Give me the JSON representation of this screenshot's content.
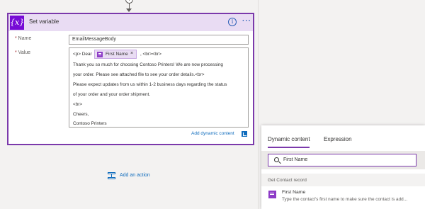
{
  "card": {
    "title": "Set variable",
    "icon_glyph": "{x}",
    "info_glyph": "i",
    "more_glyph": "···",
    "accent_color": "#7b39ab",
    "name_label": "Name",
    "name_value": "EmailMessageBody",
    "value_label": "Value",
    "value_lines": {
      "l0_before": "<p> Dear",
      "token_label": "First Name",
      "token_close": "×",
      "l0_after": ", <br><br>",
      "l1": "Thank you so much for choosing Contoso Printers! We are now processing",
      "l2": "your order. Please see attached file to see your order details.<br>",
      "l3": "Please expect updates from us within 1-2 business days regarding the status",
      "l4": "of your order and your order shipment.",
      "l5": "<br>",
      "l6": "Cheers,",
      "l7": "Contoso Printers"
    },
    "add_dynamic": "Add dynamic content"
  },
  "add_action": "Add an action",
  "plus_glyph": "+",
  "panel": {
    "tabs": [
      "Dynamic content",
      "Expression"
    ],
    "search_value": "First Name",
    "section": "Get Contact record",
    "result_title": "First Name",
    "result_desc": "Type the contact's first name to make sure the contact is add..."
  }
}
